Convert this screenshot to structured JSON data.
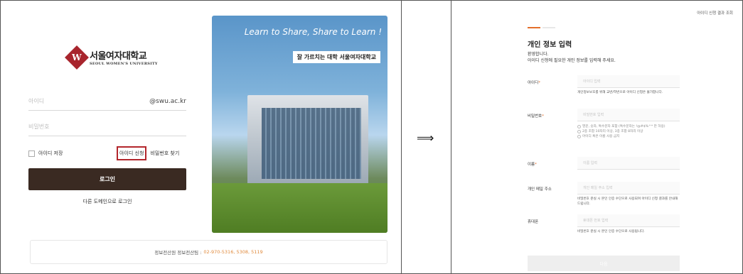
{
  "login": {
    "logo": {
      "name_ko": "서울여자대학교",
      "name_en": "SEOUL WOMEN'S UNIVERSITY",
      "mark": "W"
    },
    "id_placeholder": "아이디",
    "domain_suffix": "@swu.ac.kr",
    "password_placeholder": "비밀번호",
    "save_id_label": "아이디 저장",
    "apply_id_link": "아이디 신청",
    "find_password_link": "비밀번호 찾기",
    "login_button": "로그인",
    "other_domain_link": "다른 도메인으로 로그인",
    "banner": {
      "slogan": "Learn to Share, Share to Learn !",
      "tag": "잘 가르치는 대학 서울여자대학교"
    },
    "footer": {
      "text": "정보전산원 정보전산팀 :",
      "phone": "02-970-5316, 5308, 5119"
    }
  },
  "arrow": "⟹",
  "form": {
    "top_link": "아이디 신청 결과 조회",
    "title": "개인 정보 입력",
    "desc_line1": "환영합니다.",
    "desc_line2": "아이디 신청에 필요한 개인 정보를 입력해 주세요.",
    "fields": {
      "id": {
        "label": "아이디",
        "placeholder": "아이디 입력",
        "help": "개인정보보호를 위해 교번/학번으로 아이디 신청은 불가합니다."
      },
      "password": {
        "label": "비밀번호",
        "placeholder": "비밀번호 입력",
        "rules": [
          "영문, 숫자, 특수문자 포함 (특수문자는 !@#$%^* 만 허용)",
          "2종 조합 10자리 이상, 3종 조합 8자리 이상",
          "아이디 혹은 이름 사용 금지"
        ]
      },
      "name": {
        "label": "이름",
        "placeholder": "이름 입력"
      },
      "email": {
        "label": "개인 메일 주소",
        "placeholder": "개인 메일 주소 입력",
        "help": "비밀번호 분실 시 본인 인증 수단으로 사용되며 아이디 신청 결과를 안내해 드립니다."
      },
      "phone": {
        "label": "휴대폰",
        "placeholder": "휴대폰 번호 입력",
        "help": "비밀번호 분실 시 본인 인증 수단으로 사용됩니다."
      }
    },
    "required_mark": "*",
    "next_button": "다음"
  },
  "colors": {
    "accent": "#e46f2a",
    "brand": "#a8252d",
    "login_button": "#3a2a22",
    "highlight_box": "#b3262c"
  }
}
